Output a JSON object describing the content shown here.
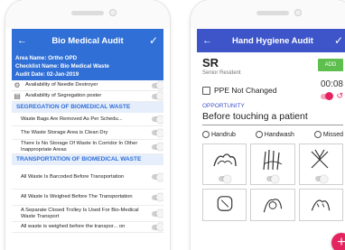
{
  "left": {
    "title": "Bio Medical Audit",
    "info": {
      "area": "Area Name: Ortho OPD",
      "checklist": "Checklist Name: Bio Medical Waste",
      "date": "Audit Date: 02-Jan-2019"
    },
    "top_items": [
      {
        "label": "Availability of Needle Destroyer",
        "icon": "needle-destroyer-icon"
      },
      {
        "label": "Availability of Segregation poster",
        "icon": "poster-icon"
      }
    ],
    "section1": "SEGREGATION OF BIOMEDICAL WASTE",
    "section1_items": [
      "Waste Bags Are Removed As Per Schedu...",
      "The Waste Storage Area is Clean  Dry",
      "There Is No Storage Of Waste In Corridor In Other Inappropriate Areas"
    ],
    "section2": "TRANSPORTATION OF BIOMEDICAL WASTE",
    "section2_items": [
      "All Waste Is Barcoded Before Transportation",
      "All Waste Is Weighed Before The Transportation",
      "A Separate Closed Trolley Is Used For Bio-Medical Waste Transport",
      "All waste is weighed before the transpor... on"
    ]
  },
  "right": {
    "title": "Hand Hygiene Audit",
    "staff_initials": "SR",
    "staff_role": "Senior Resident",
    "add_label": "ADD",
    "ppe_label": "PPE Not Changed",
    "timer": "00:08",
    "opportunity_label": "OPPORTUNITY",
    "moment": "Before touching a patient",
    "options": [
      "Handrub",
      "Handwash",
      "Missed"
    ]
  },
  "colors": {
    "blue_bar": "#2f6fd6",
    "indigo_bar": "#3d55c9",
    "accent": "#e5245f",
    "add_green": "#5fbf4e"
  }
}
